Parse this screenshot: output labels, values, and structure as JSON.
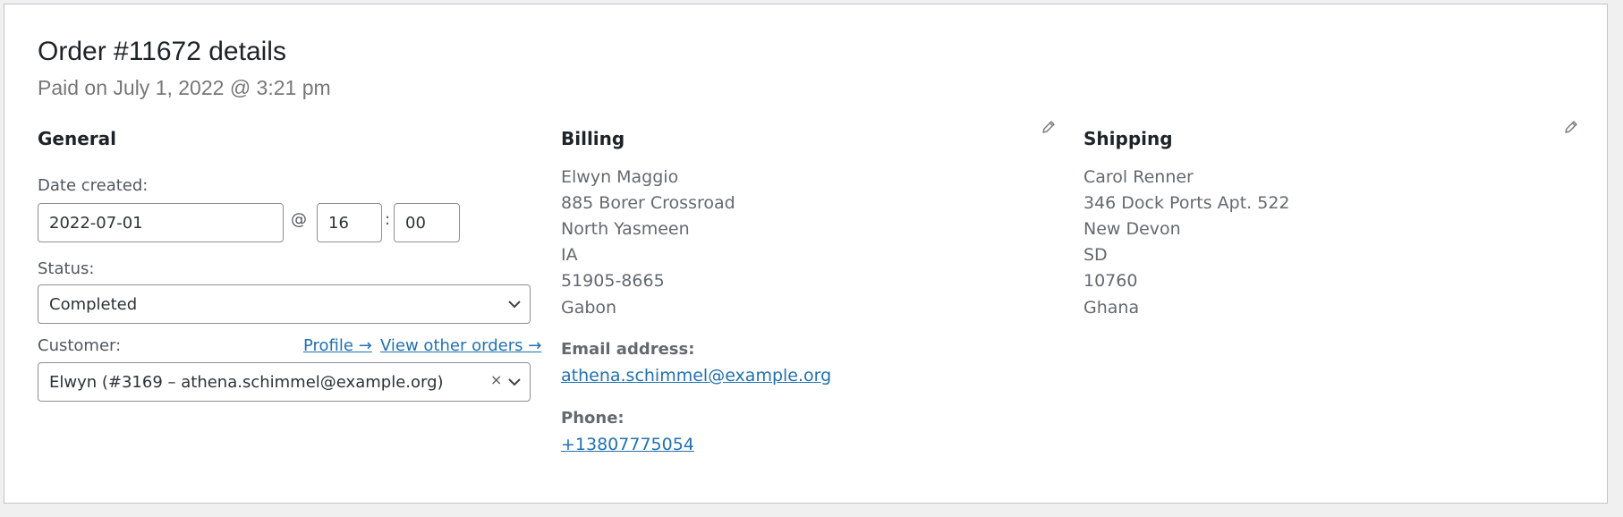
{
  "order": {
    "title": "Order #11672 details",
    "paid_line": "Paid on July 1, 2022 @ 3:21 pm"
  },
  "general": {
    "heading": "General",
    "date_label": "Date created:",
    "date_value": "2022-07-01",
    "at_sep": "@",
    "hour_value": "16",
    "colon_sep": ":",
    "minute_value": "00",
    "status_label": "Status:",
    "status_value": "Completed",
    "customer_label": "Customer:",
    "profile_link": "Profile →",
    "view_orders_link": "View other orders →",
    "customer_value": "Elwyn (#3169 – athena.schimmel@example.org)",
    "clear_glyph": "×"
  },
  "billing": {
    "heading": "Billing",
    "address": [
      "Elwyn Maggio",
      "885 Borer Crossroad",
      "North Yasmeen",
      "IA",
      "51905-8665",
      "Gabon"
    ],
    "email_label": "Email address:",
    "email": "athena.schimmel@example.org",
    "phone_label": "Phone:",
    "phone": "+13807775054"
  },
  "shipping": {
    "heading": "Shipping",
    "address": [
      "Carol Renner",
      "346 Dock Ports Apt. 522",
      "New Devon",
      "SD",
      "10760",
      "Ghana"
    ]
  },
  "icons": {
    "edit": "pencil-icon",
    "dropdown": "chevron-down-icon",
    "clear": "close-icon"
  },
  "colors": {
    "link": "#2271b1",
    "heading": "#1d2327",
    "muted": "#646970",
    "border": "#8c8f94"
  }
}
